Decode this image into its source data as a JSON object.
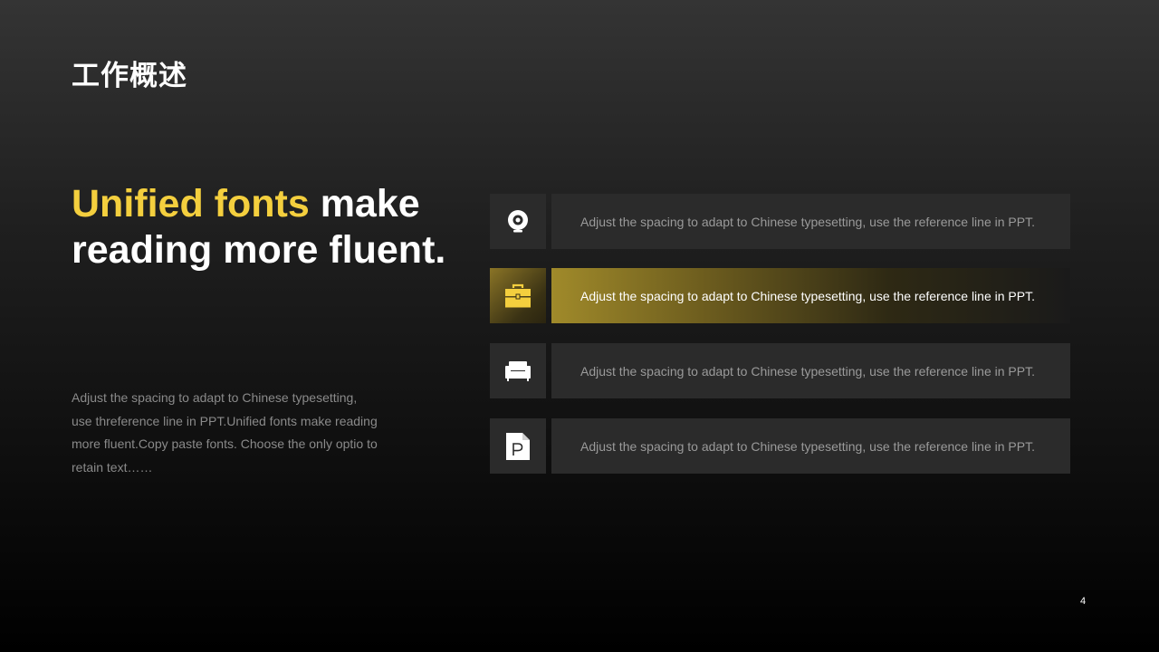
{
  "page_title": "工作概述",
  "headline": {
    "accent": "Unified fonts",
    "rest": " make reading more fluent."
  },
  "description": "Adjust the spacing to adapt to Chinese typesetting, use threference line in PPT.Unified fonts make reading more fluent.Copy paste fonts. Choose the only optio to retain text……",
  "features": [
    {
      "icon": "webcam-icon",
      "text": "Adjust the spacing to adapt to Chinese typesetting, use the reference line in PPT.",
      "active": false
    },
    {
      "icon": "toolbox-icon",
      "text": "Adjust the spacing to adapt to Chinese typesetting, use the reference line in PPT.",
      "active": true
    },
    {
      "icon": "sofa-icon",
      "text": "Adjust the spacing to adapt to Chinese typesetting, use the reference line in PPT.",
      "active": false
    },
    {
      "icon": "document-p-icon",
      "text": "Adjust the spacing to adapt to Chinese typesetting, use the reference line in PPT.",
      "active": false
    }
  ],
  "page_number": "4",
  "colors": {
    "accent": "#f4cf3e",
    "panel": "#2b2b2b",
    "muted_text": "#8a8a8a"
  }
}
